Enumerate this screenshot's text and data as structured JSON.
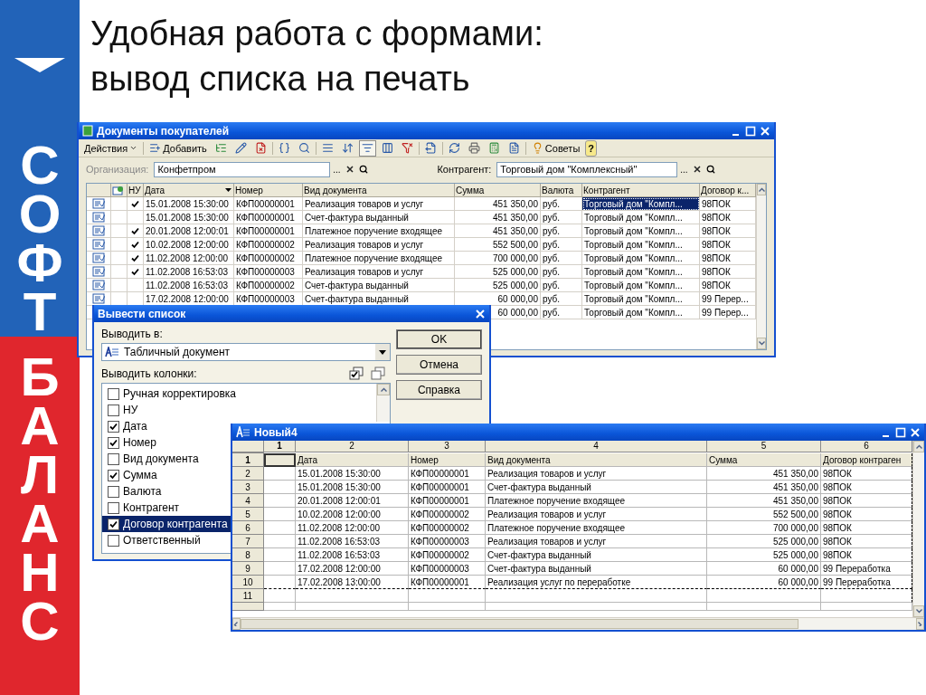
{
  "logo": {
    "top": "СОФТ",
    "bottom": "БАЛАНС"
  },
  "slide_title": [
    "Удобная работа с формами:",
    "вывод списка на печать"
  ],
  "documents_window": {
    "title": "Документы покупателей",
    "toolbar": {
      "actions": "Действия",
      "add": "Добавить",
      "tips": "Советы",
      "help": "?"
    },
    "filters": [
      {
        "label": "Организация:",
        "value": "Конфетпром",
        "disabled": true,
        "browse": "..."
      },
      {
        "label": "Контрагент:",
        "value": "Торговый дом \"Комплексный\"",
        "disabled": false,
        "browse": "..."
      }
    ],
    "columns": [
      {
        "label": "НУ",
        "sorted": false
      },
      {
        "label": "Дата",
        "sorted": true
      },
      {
        "label": "Номер",
        "sorted": false
      },
      {
        "label": "Вид документа",
        "sorted": false
      },
      {
        "label": "Сумма",
        "sorted": false
      },
      {
        "label": "Валюта",
        "sorted": false
      },
      {
        "label": "Контрагент",
        "sorted": false
      },
      {
        "label": "Договор к...",
        "sorted": false
      }
    ],
    "rows": [
      {
        "nu": true,
        "selected": true,
        "date": "15.01.2008 15:30:00",
        "number": "КФП00000001",
        "doc_type": "Реализация товаров и услуг",
        "sum": "451 350,00",
        "currency": "руб.",
        "contractor": "Торговый дом \"Компл...",
        "contract": "98ПОК"
      },
      {
        "nu": false,
        "selected": false,
        "date": "15.01.2008 15:30:00",
        "number": "КФП00000001",
        "doc_type": "Счет-фактура выданный",
        "sum": "451 350,00",
        "currency": "руб.",
        "contractor": "Торговый дом \"Компл...",
        "contract": "98ПОК"
      },
      {
        "nu": true,
        "selected": false,
        "date": "20.01.2008 12:00:01",
        "number": "КФП00000001",
        "doc_type": "Платежное поручение входящее",
        "sum": "451 350,00",
        "currency": "руб.",
        "contractor": "Торговый дом \"Компл...",
        "contract": "98ПОК"
      },
      {
        "nu": true,
        "selected": false,
        "date": "10.02.2008 12:00:00",
        "number": "КФП00000002",
        "doc_type": "Реализация товаров и услуг",
        "sum": "552 500,00",
        "currency": "руб.",
        "contractor": "Торговый дом \"Компл...",
        "contract": "98ПОК"
      },
      {
        "nu": true,
        "selected": false,
        "date": "11.02.2008 12:00:00",
        "number": "КФП00000002",
        "doc_type": "Платежное поручение входящее",
        "sum": "700 000,00",
        "currency": "руб.",
        "contractor": "Торговый дом \"Компл...",
        "contract": "98ПОК"
      },
      {
        "nu": true,
        "selected": false,
        "date": "11.02.2008 16:53:03",
        "number": "КФП00000003",
        "doc_type": "Реализация товаров и услуг",
        "sum": "525 000,00",
        "currency": "руб.",
        "contractor": "Торговый дом \"Компл...",
        "contract": "98ПОК"
      },
      {
        "nu": false,
        "selected": false,
        "date": "11.02.2008 16:53:03",
        "number": "КФП00000002",
        "doc_type": "Счет-фактура выданный",
        "sum": "525 000,00",
        "currency": "руб.",
        "contractor": "Торговый дом \"Компл...",
        "contract": "98ПОК"
      },
      {
        "nu": false,
        "selected": false,
        "date": "17.02.2008 12:00:00",
        "number": "КФП00000003",
        "doc_type": "Счет-фактура выданный",
        "sum": "60 000,00",
        "currency": "руб.",
        "contractor": "Торговый дом \"Компл...",
        "contract": "99 Перер..."
      },
      {
        "selected": false,
        "sum": "60 000,00",
        "currency": "руб.",
        "contractor": "Торговый дом \"Компл...",
        "contract": "99 Перер..."
      }
    ]
  },
  "print_dialog": {
    "title": "Вывести список",
    "output_label": "Выводить в:",
    "output_value": "Табличный документ",
    "columns_label": "Выводить колонки:",
    "items": [
      {
        "label": "Ручная корректировка",
        "checked": false,
        "selected": false
      },
      {
        "label": "НУ",
        "checked": false,
        "selected": false
      },
      {
        "label": "Дата",
        "checked": true,
        "selected": false
      },
      {
        "label": "Номер",
        "checked": true,
        "selected": false
      },
      {
        "label": "Вид документа",
        "checked": false,
        "selected": false
      },
      {
        "label": "Сумма",
        "checked": true,
        "selected": false
      },
      {
        "label": "Валюта",
        "checked": false,
        "selected": false
      },
      {
        "label": "Контрагент",
        "checked": false,
        "selected": false
      },
      {
        "label": "Договор контрагента",
        "checked": true,
        "selected": true
      },
      {
        "label": "Ответственный",
        "checked": false,
        "selected": false
      }
    ],
    "buttons": [
      "OK",
      "Отмена",
      "Справка"
    ]
  },
  "spreadsheet_window": {
    "title": "Новый4",
    "column_numbers": [
      "1",
      "2",
      "3",
      "4",
      "5",
      "6"
    ],
    "rows": [
      {
        "number": "1",
        "kind": "header",
        "cells": [
          "Дата",
          "Номер",
          "Вид документа",
          "Сумма",
          "Договор контраген"
        ]
      },
      {
        "number": "2",
        "kind": "data",
        "cells": [
          "15.01.2008 15:30:00",
          "КФП00000001",
          "Реализация товаров и услуг",
          "451 350,00",
          "98ПОК"
        ]
      },
      {
        "number": "3",
        "kind": "data",
        "cells": [
          "15.01.2008 15:30:00",
          "КФП00000001",
          "Счет-фактура выданный",
          "451 350,00",
          "98ПОК"
        ]
      },
      {
        "number": "4",
        "kind": "data",
        "cells": [
          "20.01.2008 12:00:01",
          "КФП00000001",
          "Платежное поручение входящее",
          "451 350,00",
          "98ПОК"
        ]
      },
      {
        "number": "5",
        "kind": "data",
        "cells": [
          "10.02.2008 12:00:00",
          "КФП00000002",
          "Реализация товаров и услуг",
          "552 500,00",
          "98ПОК"
        ]
      },
      {
        "number": "6",
        "kind": "data",
        "cells": [
          "11.02.2008 12:00:00",
          "КФП00000002",
          "Платежное поручение входящее",
          "700 000,00",
          "98ПОК"
        ]
      },
      {
        "number": "7",
        "kind": "data",
        "cells": [
          "11.02.2008 16:53:03",
          "КФП00000003",
          "Реализация товаров и услуг",
          "525 000,00",
          "98ПОК"
        ]
      },
      {
        "number": "8",
        "kind": "data",
        "cells": [
          "11.02.2008 16:53:03",
          "КФП00000002",
          "Счет-фактура выданный",
          "525 000,00",
          "98ПОК"
        ]
      },
      {
        "number": "9",
        "kind": "data",
        "cells": [
          "17.02.2008 12:00:00",
          "КФП00000003",
          "Счет-фактура выданный",
          "60 000,00",
          "99 Переработка"
        ]
      },
      {
        "number": "10",
        "kind": "data",
        "cells": [
          "17.02.2008 13:00:00",
          "КФП00000001",
          "Реализация услуг по переработке",
          "60 000,00",
          "99 Переработка"
        ]
      },
      {
        "number": "11",
        "kind": "empty"
      }
    ]
  }
}
